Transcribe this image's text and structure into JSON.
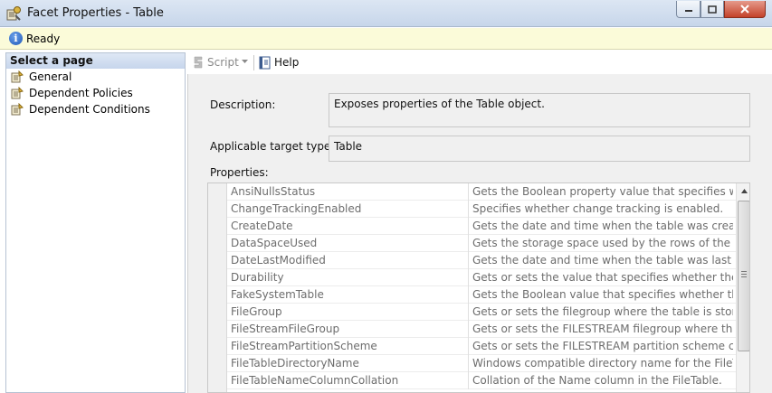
{
  "window": {
    "title": "Facet Properties - Table",
    "controls": {
      "minimize": "minimize",
      "maximize": "maximize",
      "close": "close"
    }
  },
  "status": {
    "icon": "info-icon",
    "text": "Ready"
  },
  "nav": {
    "header": "Select a page",
    "items": [
      {
        "label": "General",
        "icon": "page-icon"
      },
      {
        "label": "Dependent Policies",
        "icon": "page-icon"
      },
      {
        "label": "Dependent Conditions",
        "icon": "page-icon"
      }
    ]
  },
  "toolbar": {
    "script_label": "Script",
    "help_label": "Help"
  },
  "form": {
    "description_label": "Description:",
    "description_value": "Exposes properties of the Table object.",
    "target_types_label": "Applicable target types:",
    "target_types_value": "Table",
    "properties_label": "Properties:"
  },
  "properties": {
    "rows": [
      {
        "name": "AnsiNullsStatus",
        "desc": "Gets the Boolean property value that specifies whether"
      },
      {
        "name": "ChangeTrackingEnabled",
        "desc": "Specifies whether change tracking is enabled."
      },
      {
        "name": "CreateDate",
        "desc": "Gets the date and time when the table was created."
      },
      {
        "name": "DataSpaceUsed",
        "desc": "Gets the storage space used by the rows of the referenc"
      },
      {
        "name": "DateLastModified",
        "desc": "Gets the date and time when the table was last modifie"
      },
      {
        "name": "Durability",
        "desc": "Gets or sets the value that specifies whether the data st"
      },
      {
        "name": "FakeSystemTable",
        "desc": "Gets the Boolean value that specifies whether the table"
      },
      {
        "name": "FileGroup",
        "desc": "Gets or sets the filegroup where the table is stored."
      },
      {
        "name": "FileStreamFileGroup",
        "desc": "Gets or sets the FILESTREAM filegroup where the table i"
      },
      {
        "name": "FileStreamPartitionScheme",
        "desc": "Gets or sets the FILESTREAM partition scheme configu"
      },
      {
        "name": "FileTableDirectoryName",
        "desc": "Windows compatible directory name for the FileTable r"
      },
      {
        "name": "FileTableNameColumnCollation",
        "desc": "Collation of the Name column in the FileTable."
      }
    ]
  }
}
